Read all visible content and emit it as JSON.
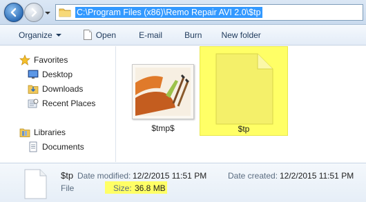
{
  "address_bar": {
    "path": "C:\\Program Files (x86)\\Remo Repair AVI 2.0\\$tp"
  },
  "toolbar": {
    "organize_label": "Organize",
    "open_label": "Open",
    "email_label": "E-mail",
    "burn_label": "Burn",
    "new_folder_label": "New folder"
  },
  "navpane": {
    "favorites_label": "Favorites",
    "favorites": [
      {
        "label": "Desktop",
        "icon": "desktop-icon"
      },
      {
        "label": "Downloads",
        "icon": "downloads-icon"
      },
      {
        "label": "Recent Places",
        "icon": "recent-places-icon"
      }
    ],
    "libraries_label": "Libraries",
    "libraries": [
      {
        "label": "Documents",
        "icon": "documents-icon"
      }
    ]
  },
  "files": [
    {
      "name": "$tmp$",
      "icon": "image-thumbnail",
      "selected": false
    },
    {
      "name": "$tp",
      "icon": "generic-file-icon",
      "selected": true
    }
  ],
  "details": {
    "name": "$tp",
    "type": "File",
    "date_modified_label": "Date modified:",
    "date_modified": "12/2/2015 11:51 PM",
    "date_created_label": "Date created:",
    "date_created": "12/2/2015 11:51 PM",
    "size_label": "Size:",
    "size": "36.8 MB"
  },
  "colors": {
    "highlight": "#ffff66",
    "address_selection": "#3399ff",
    "toolbar_text": "#1e395b"
  }
}
